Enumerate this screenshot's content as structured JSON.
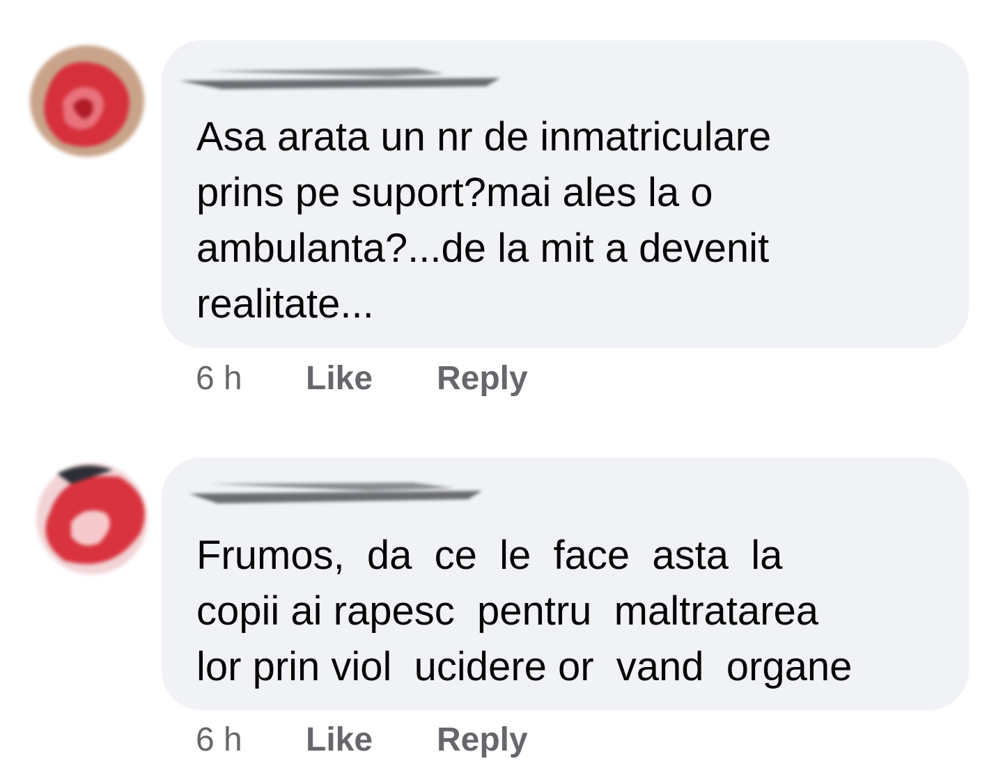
{
  "comments": [
    {
      "avatar": "blurred-profile-photo",
      "author": "",
      "lines": [
        "Asa arata un nr de inmatriculare",
        "prins pe suport?mai ales la o",
        "ambulanta?...de la mit a devenit",
        "realitate..."
      ],
      "timestamp": "6 h",
      "like_label": "Like",
      "reply_label": "Reply"
    },
    {
      "avatar": "blurred-profile-photo",
      "author": "",
      "lines": [
        "Frumos,  da  ce  le  face  asta  la",
        "copii ai rapesc  pentru  maltratarea",
        "lor prin viol  ucidere or  vand  organe"
      ],
      "timestamp": "6 h",
      "like_label": "Like",
      "reply_label": "Reply"
    }
  ],
  "colors": {
    "bubble_background": "#f0f2f5",
    "text": "#050505",
    "secondary_text": "#65676b"
  }
}
